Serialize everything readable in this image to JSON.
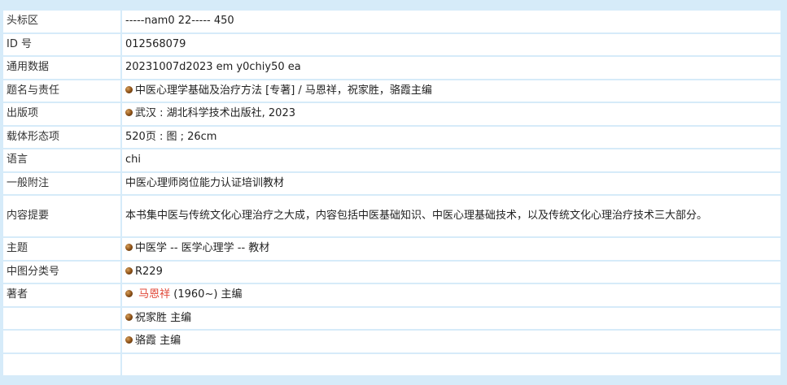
{
  "rows": [
    {
      "label": "头标区",
      "value": "-----nam0 22----- 450"
    },
    {
      "label": "ID 号",
      "value": "012568079"
    },
    {
      "label": "通用数据",
      "value": "20231007d2023 em y0chiy50 ea"
    },
    {
      "label": "题名与责任",
      "value": "中医心理学基础及治疗方法 [专著] / 马恩祥，祝家胜，骆霞主编"
    },
    {
      "label": "出版项",
      "value": "武汉 : 湖北科学技术出版社, 2023"
    },
    {
      "label": "载体形态项",
      "value": "520页 : 图 ; 26cm"
    },
    {
      "label": "语言",
      "value": "chi"
    },
    {
      "label": "一般附注",
      "value": "中医心理师岗位能力认证培训教材"
    },
    {
      "label": "内容提要",
      "value": "本书集中医与传统文化心理治疗之大成，内容包括中医基础知识、中医心理基础技术，以及传统文化心理治疗技术三大部分。"
    },
    {
      "label": "主题",
      "value": "中医学 -- 医学心理学 -- 教材"
    },
    {
      "label": "中图分类号",
      "value": "R229"
    }
  ],
  "authors": {
    "label": "著者",
    "primary": {
      "name": "马恩祥",
      "suffix": " (1960~) 主编"
    },
    "others": [
      "祝家胜 主编",
      "骆霞 主编"
    ]
  },
  "icons": {
    "bullet": "bullet-icon"
  },
  "colors": {
    "background": "#d6ebf9",
    "link": "#e04a3a"
  }
}
